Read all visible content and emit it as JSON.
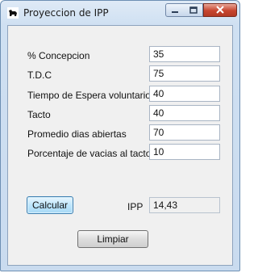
{
  "window": {
    "title": "Proyeccion de IPP",
    "icons": [
      "app-icon",
      "minimize-icon",
      "maximize-icon",
      "close-icon"
    ]
  },
  "form": {
    "rows": [
      {
        "label": "% Concepcion",
        "value": "35"
      },
      {
        "label": "T.D.C",
        "value": "75"
      },
      {
        "label": "Tiempo de Espera voluntario",
        "value": "40"
      },
      {
        "label": "Tacto",
        "value": "40"
      },
      {
        "label": "Promedio dias abiertas",
        "value": "70"
      },
      {
        "label": "Porcentaje de vacias al tacto",
        "value": "10"
      }
    ],
    "calcular_label": "Calcular",
    "ipp_label": "IPP",
    "ipp_value": "14,43",
    "limpiar_label": "Limpiar"
  }
}
